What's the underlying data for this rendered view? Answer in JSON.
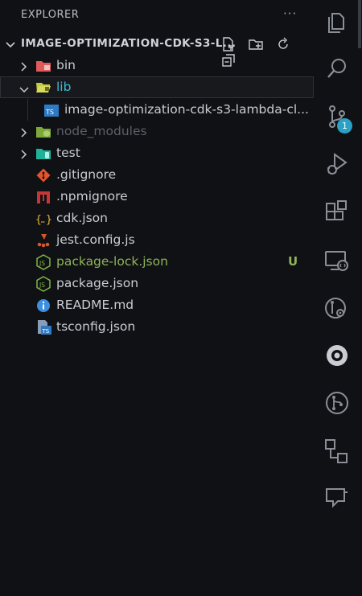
{
  "explorer": {
    "header": "EXPLORER",
    "more": "···",
    "project_title": "IMAGE-OPTIMIZATION-CDK-S3-L..."
  },
  "tree": {
    "bin": "bin",
    "lib": "lib",
    "lib_child": "image-optimization-cdk-s3-lambda-cl...",
    "node_modules": "node_modules",
    "test": "test",
    "gitignore": ".gitignore",
    "npmignore": ".npmignore",
    "cdk": "cdk.json",
    "jest": "jest.config.js",
    "package_lock": "package-lock.json",
    "package_lock_status": "U",
    "package": "package.json",
    "readme": "README.md",
    "tsconfig": "tsconfig.json"
  },
  "activity_bar": {
    "source_control_badge": "1",
    "icons": [
      "explorer-icon",
      "search-icon",
      "source-control-icon",
      "run-debug-icon",
      "extensions-icon",
      "remote-explorer-icon",
      "git-graph-icon",
      "circleci-icon",
      "git-pr-icon",
      "architecture-icon",
      "chat-icon"
    ]
  },
  "colors": {
    "background": "#101114",
    "untracked_green": "#8fb35a",
    "folder_cyan": "#3fb9d6",
    "badge": "#2ba1c5"
  }
}
